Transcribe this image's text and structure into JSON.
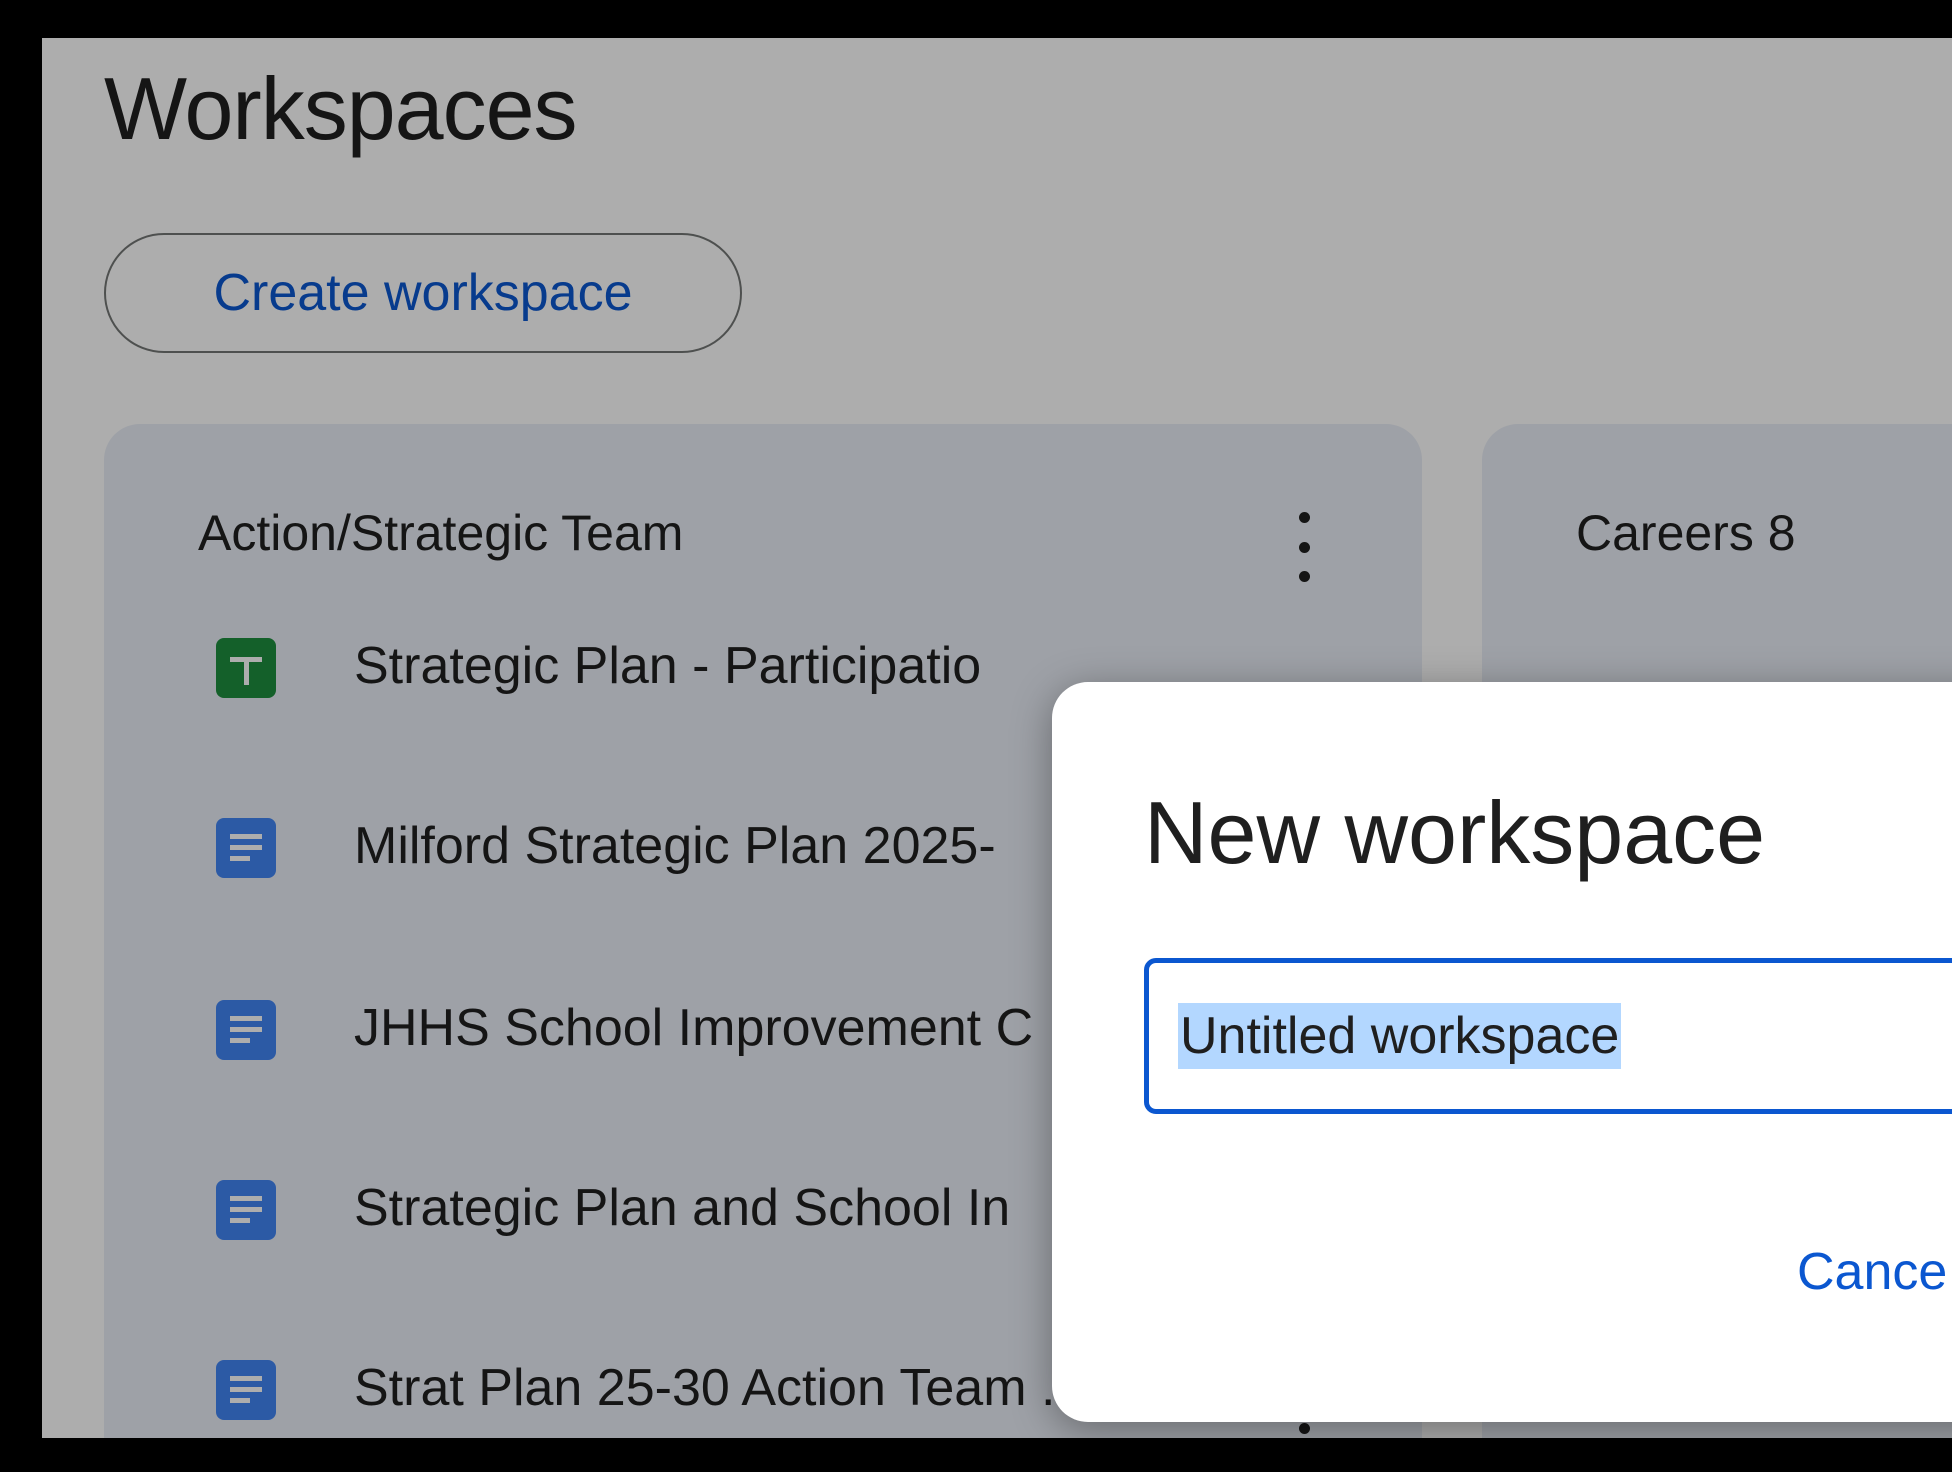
{
  "page": {
    "title": "Workspaces",
    "create_button_label": "Create workspace"
  },
  "workspaces": [
    {
      "name": "Action/Strategic Team",
      "files": [
        {
          "type": "sheets",
          "name": "Strategic Plan - Participatio"
        },
        {
          "type": "docs",
          "name": "Milford Strategic Plan 2025-"
        },
        {
          "type": "docs",
          "name": "JHHS School Improvement C"
        },
        {
          "type": "docs",
          "name": "Strategic Plan and School In"
        },
        {
          "type": "docs",
          "name": "Strat Plan 25-30 Action Team ..."
        }
      ]
    },
    {
      "name": "Careers 8",
      "files": []
    }
  ],
  "dialog": {
    "title": "New workspace",
    "input_value": "Untitled workspace",
    "cancel_label": "Cance"
  },
  "colors": {
    "accent": "#0b57d0",
    "card_bg": "#e9eef6",
    "sheets_icon": "#1e8e3e",
    "docs_icon": "#4285f4",
    "selection": "#b3d7ff"
  },
  "icons": {
    "sheets": "google-sheets-icon",
    "docs": "google-docs-icon",
    "more": "more-vert-icon"
  }
}
